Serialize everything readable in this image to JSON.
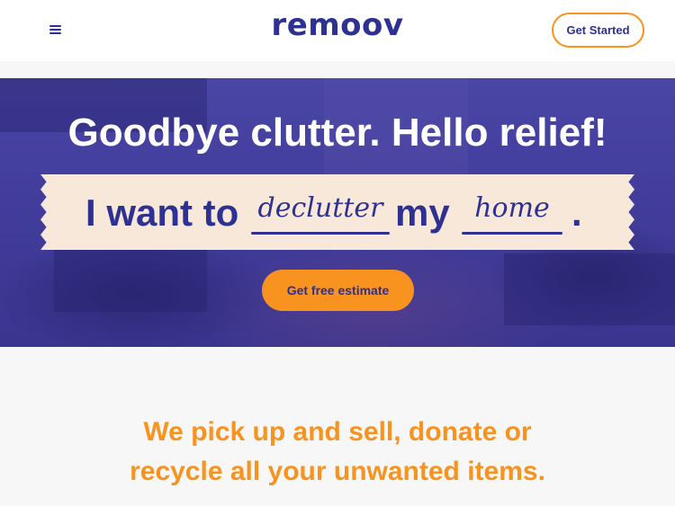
{
  "header": {
    "menu_icon": "hamburger-menu-icon",
    "logo": "remoov",
    "get_started_label": "Get Started"
  },
  "hero": {
    "title": "Goodbye clutter. Hello relief!",
    "banner": {
      "prefix": "I want to",
      "action": "declutter",
      "middle": "my",
      "place": "home",
      "suffix": "."
    },
    "cta_label": "Get free estimate"
  },
  "tagline": {
    "line1": "We pick up and sell, donate or",
    "line2": "recycle all your unwanted items."
  },
  "colors": {
    "brand_navy": "#2e3192",
    "accent_orange": "#f7931e",
    "banner_cream": "#f7e8da"
  }
}
